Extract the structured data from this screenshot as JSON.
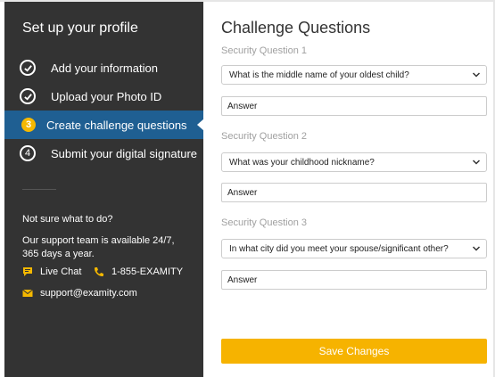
{
  "sidebar": {
    "title": "Set up your profile",
    "steps": [
      {
        "number": "1",
        "label": "Add your information",
        "status": "done"
      },
      {
        "number": "2",
        "label": "Upload your Photo ID",
        "status": "done"
      },
      {
        "number": "3",
        "label": "Create challenge questions",
        "status": "active"
      },
      {
        "number": "4",
        "label": "Submit your digital signature",
        "status": "pending"
      }
    ],
    "help": {
      "question": "Not sure what to do?",
      "text": "Our support team is available 24/7, 365 days a year.",
      "live_chat": "Live Chat",
      "phone": "1-855-EXAMITY",
      "email": "support@examity.com"
    }
  },
  "main": {
    "title": "Challenge Questions",
    "questions": [
      {
        "label": "Security Question 1",
        "selected": "What is the middle name of your oldest child?",
        "answer_value": "Answer"
      },
      {
        "label": "Security Question 2",
        "selected": "What was your childhood nickname?",
        "answer_value": "Answer"
      },
      {
        "label": "Security Question 3",
        "selected": "In what city did you meet your spouse/significant other?",
        "answer_value": "Answer"
      }
    ],
    "save_label": "Save Changes"
  },
  "colors": {
    "sidebar_bg": "#333333",
    "active_step_bg": "#1f5f92",
    "accent": "#f5b800",
    "button": "#f6b300"
  },
  "icons": {
    "done": "check-circle-icon",
    "chat": "chat-bubble-icon",
    "phone": "phone-icon",
    "email": "envelope-icon",
    "select": "chevron-down-icon"
  }
}
